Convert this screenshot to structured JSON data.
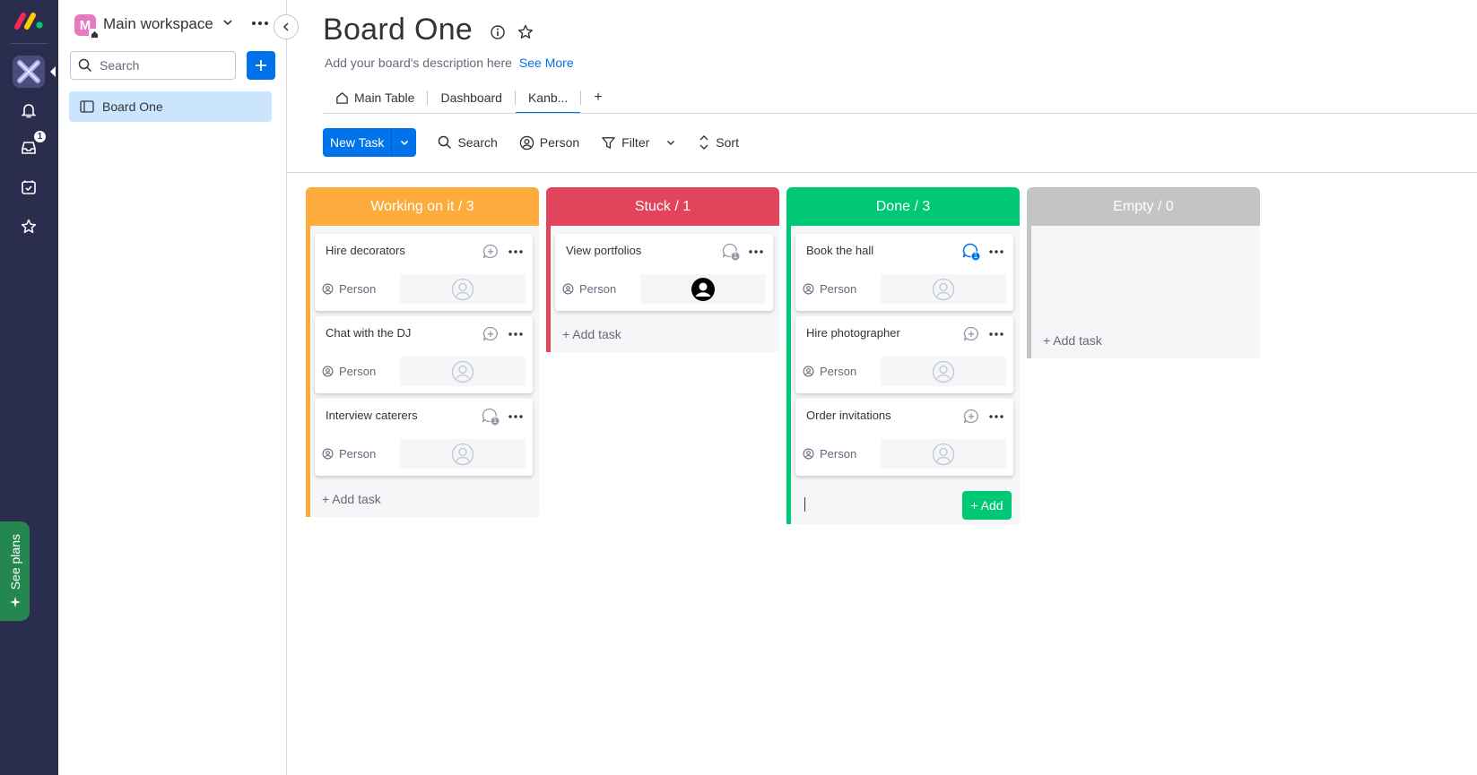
{
  "workspace": {
    "avatar_letter": "M",
    "name": "Main workspace",
    "search_placeholder": "Search",
    "boards": [
      {
        "label": "Board One"
      }
    ]
  },
  "rail": {
    "inbox_badge": "1",
    "see_plans": "See plans"
  },
  "header": {
    "title": "Board One",
    "description": "Add your board's description here",
    "see_more": "See More"
  },
  "tabs": [
    {
      "label": "Main Table"
    },
    {
      "label": "Dashboard"
    },
    {
      "label": "Kanb..."
    }
  ],
  "tabs_add": "+",
  "toolbar": {
    "new_task": "New Task",
    "search": "Search",
    "person": "Person",
    "filter": "Filter",
    "sort": "Sort"
  },
  "columns": [
    {
      "title": "Working on it / 3",
      "color": "#fdab3d",
      "cards": [
        {
          "title": "Hire decorators",
          "person_label": "Person",
          "updates": ""
        },
        {
          "title": "Chat with the DJ",
          "person_label": "Person",
          "updates": ""
        },
        {
          "title": "Interview caterers",
          "person_label": "Person",
          "updates": "1"
        }
      ],
      "add_task": "+ Add task"
    },
    {
      "title": "Stuck / 1",
      "color": "#e2445c",
      "cards": [
        {
          "title": "View portfolios",
          "person_label": "Person",
          "updates": "1"
        }
      ],
      "add_task": "+ Add task"
    },
    {
      "title": "Done / 3",
      "color": "#00c875",
      "cards": [
        {
          "title": "Book the hall",
          "person_label": "Person",
          "updates": "1"
        },
        {
          "title": "Hire photographer",
          "person_label": "Person",
          "updates": ""
        },
        {
          "title": "Order invitations",
          "person_label": "Person",
          "updates": ""
        }
      ],
      "add_button": "+ Add"
    },
    {
      "title": "Empty / 0",
      "color": "#c4c4c4",
      "cards": [],
      "add_task": "+ Add task"
    }
  ]
}
